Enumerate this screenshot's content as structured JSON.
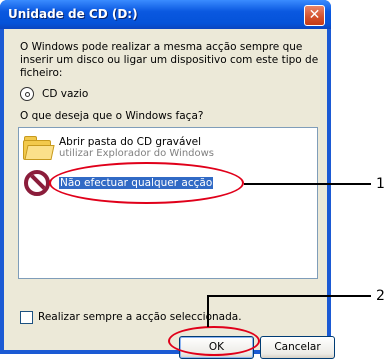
{
  "window": {
    "title": "Unidade de CD (D:)",
    "close_glyph": "✕"
  },
  "dialog": {
    "intro_text": "O Windows pode realizar a mesma acção sempre que inserir um disco ou ligar um dispositivo com este tipo de ficheiro:",
    "content_type_label": "CD vazio",
    "question": "O que deseja que o Windows faça?",
    "options": [
      {
        "title": "Abrir pasta do CD gravável",
        "subtitle": "utilizar Explorador do Windows",
        "icon": "folder-icon"
      },
      {
        "title": "Não efectuar qualquer acção",
        "icon": "no-action-icon",
        "selected": true
      }
    ],
    "always_checkbox_label": "Realizar sempre a acção seleccionada.",
    "always_checked": false,
    "ok_label": "OK",
    "cancel_label": "Cancelar"
  },
  "callouts": {
    "first": "1",
    "second": "2"
  },
  "colors": {
    "titlebar": "#0553d9",
    "selection": "#316ac5",
    "callout": "#e0001a",
    "dialog_bg": "#ece9d8"
  }
}
